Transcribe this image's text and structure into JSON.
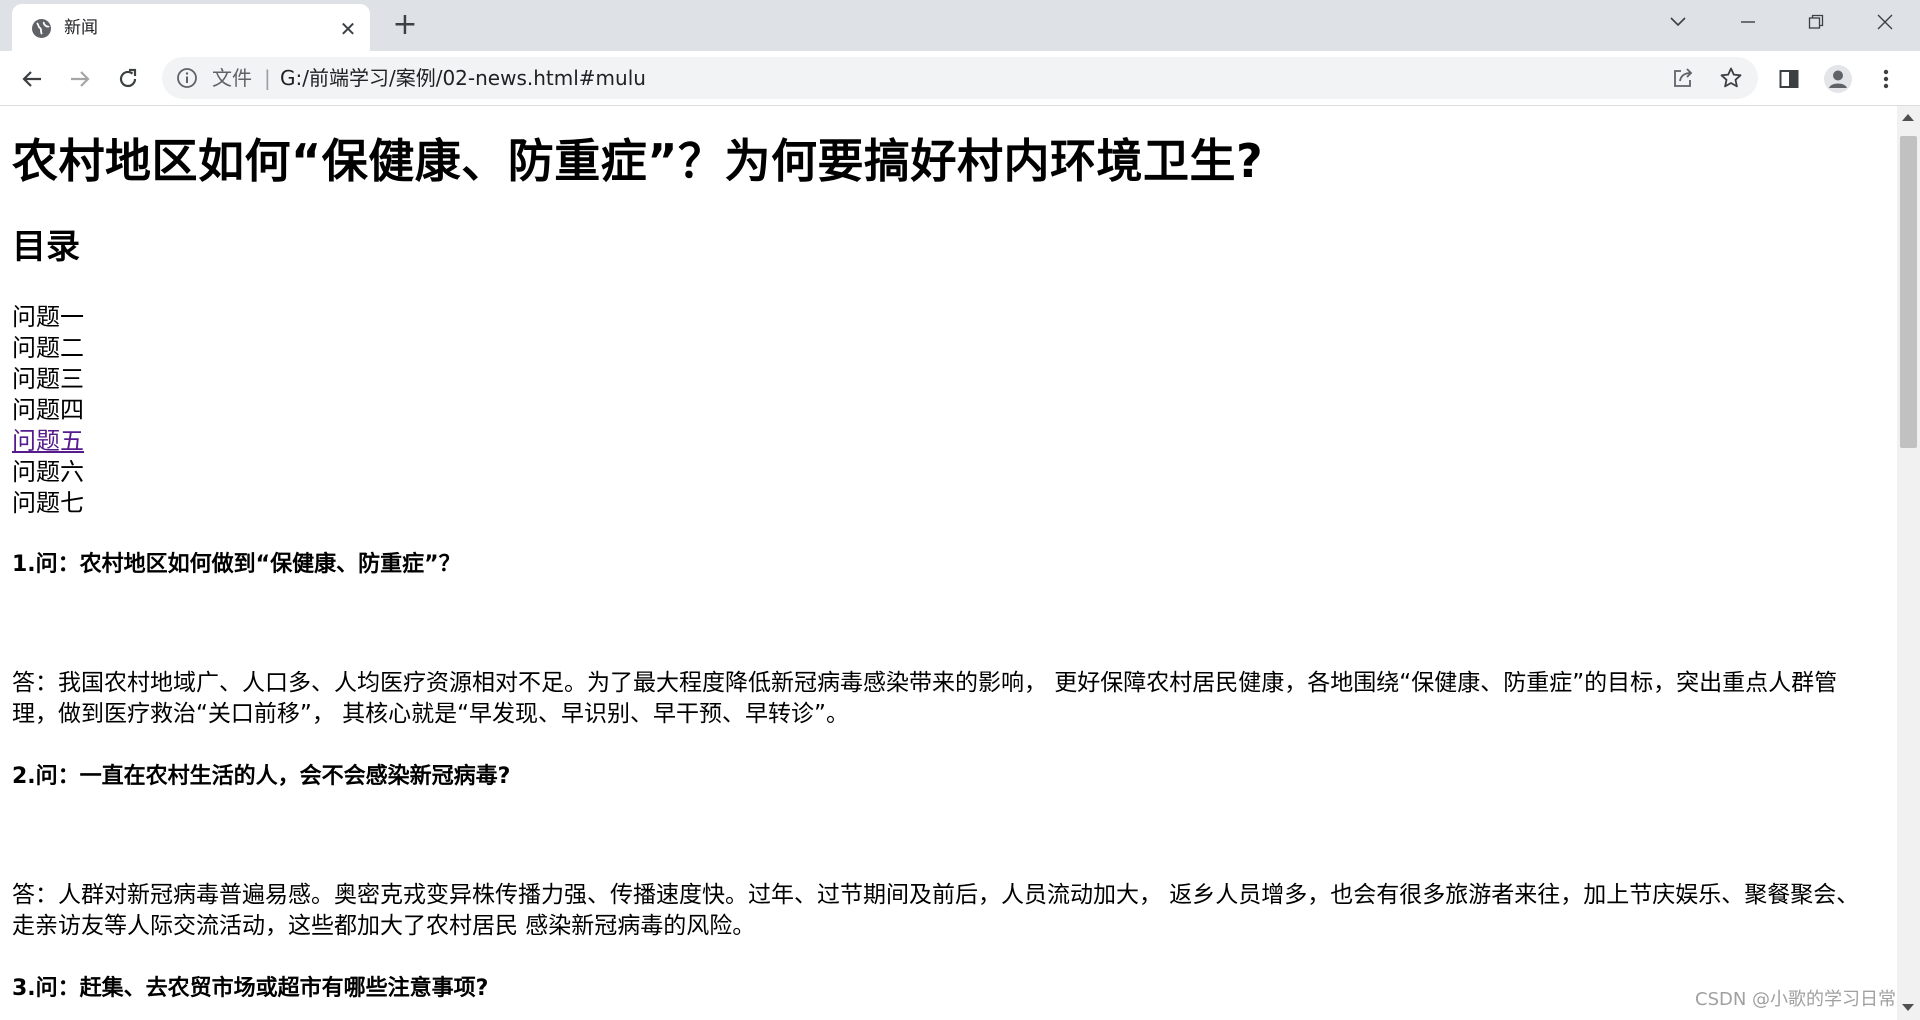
{
  "browser": {
    "tab_title": "新闻",
    "url_scheme": "文件",
    "url_separator": "|",
    "url": "G:/前端学习/案例/02-news.html#mulu",
    "icons": [
      "globe-icon",
      "close-icon",
      "plus-icon",
      "chevron-down-icon",
      "minimize-icon",
      "restore-icon",
      "window-close-icon",
      "back-arrow-icon",
      "forward-arrow-icon",
      "reload-icon",
      "info-icon",
      "share-icon",
      "star-icon",
      "side-panel-icon",
      "profile-icon",
      "kebab-menu-icon"
    ]
  },
  "page": {
    "title": "农村地区如何“保健康、防重症”？为何要搞好村内环境卫生?",
    "toc_heading": "目录",
    "toc": [
      {
        "label": "问题一"
      },
      {
        "label": "问题二"
      },
      {
        "label": "问题三"
      },
      {
        "label": "问题四"
      },
      {
        "label": "问题五",
        "visited": true
      },
      {
        "label": "问题六"
      },
      {
        "label": "问题七"
      }
    ],
    "sections": [
      {
        "question": "1.问：农村地区如何做到“保健康、防重症”？",
        "answer": "答：我国农村地域广、人口多、人均医疗资源相对不足。为了最大程度降低新冠病毒感染带来的影响， 更好保障农村居民健康，各地围绕“保健康、防重症”的目标，突出重点人群管理，做到医疗救治“关口前移”， 其核心就是“早发现、早识别、早干预、早转诊”。"
      },
      {
        "question": "2.问：一直在农村生活的人，会不会感染新冠病毒?",
        "answer": "答：人群对新冠病毒普遍易感。奥密克戎变异株传播力强、传播速度快。过年、过节期间及前后，人员流动加大， 返乡人员增多，也会有很多旅游者来往，加上节庆娱乐、聚餐聚会、走亲访友等人际交流活动，这些都加大了农村居民 感染新冠病毒的风险。"
      },
      {
        "question": "3.问：赶集、去农贸市场或超市有哪些注意事项?",
        "answer": ""
      }
    ]
  },
  "watermark": "CSDN @小歌的学习日常",
  "colors": {
    "tabstrip_bg": "#dee1e6",
    "omnibox_bg": "#f1f3f4",
    "visited_link": "#551a8b"
  }
}
